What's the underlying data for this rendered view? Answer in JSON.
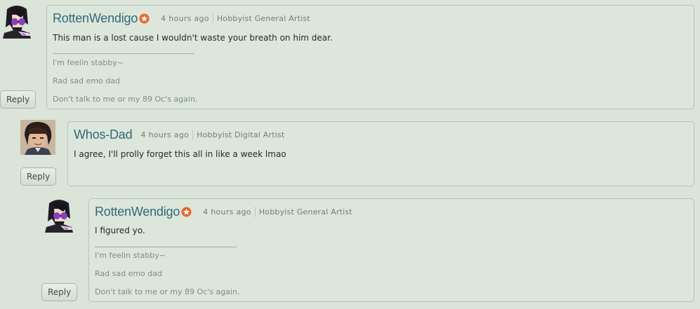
{
  "comments": [
    {
      "username": "RottenWendigo",
      "time": "4 hours ago",
      "role": "Hobbyist General Artist",
      "text": "This man is a lost cause I wouldn't waste your breath on him dear.",
      "signature": [
        "I'm feelin stabby~",
        "Rad sad emo dad",
        "Don't talk to me or my 89 Oc's again."
      ],
      "reply_label": "Reply",
      "has_badge": true
    },
    {
      "username": "Whos-Dad",
      "time": "4 hours ago",
      "role": "Hobbyist Digital Artist",
      "text": "I agree, I'll prolly forget this all in like a week lmao",
      "signature": [],
      "reply_label": "Reply",
      "has_badge": false
    },
    {
      "username": "RottenWendigo",
      "time": "4 hours ago",
      "role": "Hobbyist General Artist",
      "text": "I figured yo.",
      "signature": [
        "I'm feelin stabby~",
        "Rad sad emo dad",
        "Don't talk to me or my 89 Oc's again."
      ],
      "reply_label": "Reply",
      "has_badge": true
    }
  ],
  "colors": {
    "background": "#dae4d9",
    "username": "#2f6b7c",
    "badge": "#e8672c"
  }
}
